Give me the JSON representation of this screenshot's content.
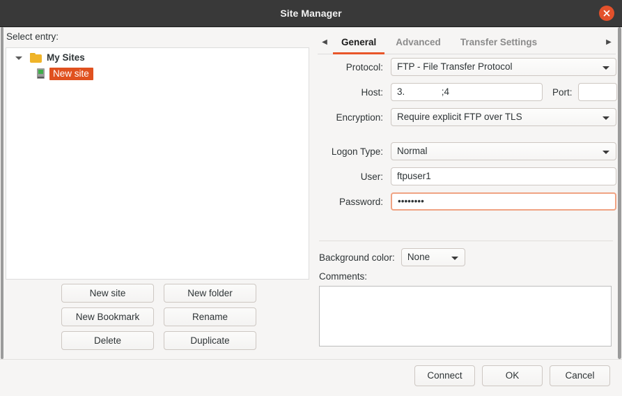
{
  "window": {
    "title": "Site Manager",
    "close_icon": "close-icon",
    "accent_color": "#e8562a",
    "selection_color": "#e0511f",
    "titlebar_color": "#393939"
  },
  "left": {
    "select_entry_label": "Select entry:",
    "tree": {
      "root": {
        "label": "My Sites",
        "icon": "folder-icon",
        "expanded": true,
        "disclosure_icon": "chevron-down-icon"
      },
      "children": [
        {
          "label": "New site",
          "icon": "server-icon",
          "selected": true
        }
      ]
    },
    "buttons": [
      {
        "label": "New site"
      },
      {
        "label": "New folder"
      },
      {
        "label": "New Bookmark"
      },
      {
        "label": "Rename"
      },
      {
        "label": "Delete"
      },
      {
        "label": "Duplicate"
      }
    ]
  },
  "right": {
    "tabs": {
      "scroll_left_icon": "chevron-left-icon",
      "scroll_right_icon": "chevron-right-icon",
      "items": [
        {
          "label": "General",
          "active": true
        },
        {
          "label": "Advanced",
          "active": false
        },
        {
          "label": "Transfer Settings",
          "active": false
        }
      ]
    },
    "general": {
      "protocol": {
        "label": "Protocol:",
        "value": "FTP - File Transfer Protocol",
        "caret_icon": "chevron-down-icon"
      },
      "host": {
        "label": "Host:",
        "value": "3.              ;4"
      },
      "port": {
        "label": "Port:",
        "value": ""
      },
      "encryption": {
        "label": "Encryption:",
        "value": "Require explicit FTP over TLS",
        "caret_icon": "chevron-down-icon"
      },
      "logon_type": {
        "label": "Logon Type:",
        "value": "Normal",
        "caret_icon": "chevron-down-icon"
      },
      "user": {
        "label": "User:",
        "value": "ftpuser1"
      },
      "password": {
        "label": "Password:",
        "value": "••••••••",
        "focused": true
      },
      "background_color": {
        "label": "Background color:",
        "value": "None",
        "caret_icon": "chevron-down-icon"
      },
      "comments": {
        "label": "Comments:",
        "value": ""
      }
    }
  },
  "footer": {
    "buttons": [
      {
        "label": "Connect"
      },
      {
        "label": "OK"
      },
      {
        "label": "Cancel"
      }
    ]
  }
}
